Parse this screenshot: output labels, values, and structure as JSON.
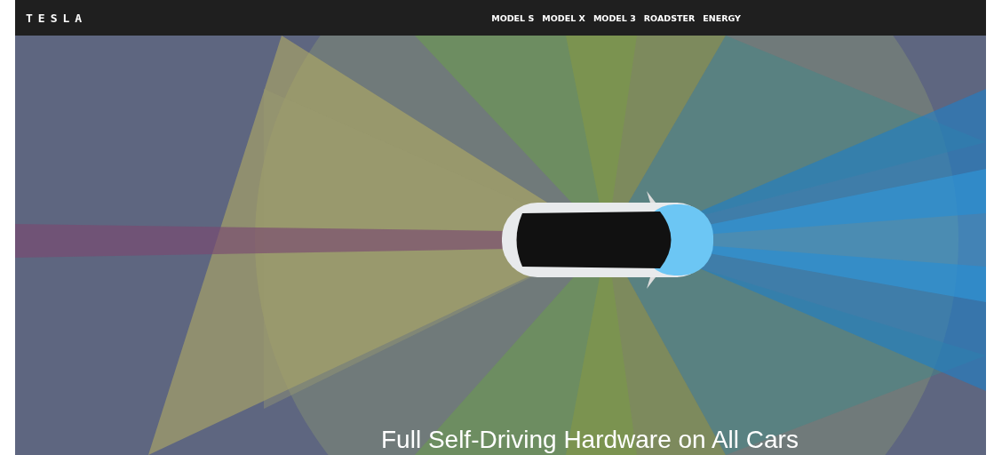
{
  "header": {
    "logo": "TESLA",
    "nav": [
      {
        "label": "MODEL S"
      },
      {
        "label": "MODEL X"
      },
      {
        "label": "MODEL 3"
      },
      {
        "label": "ROADSTER"
      },
      {
        "label": "ENERGY"
      }
    ]
  },
  "hero": {
    "headline": "Full Self-Driving Hardware on All Cars"
  }
}
